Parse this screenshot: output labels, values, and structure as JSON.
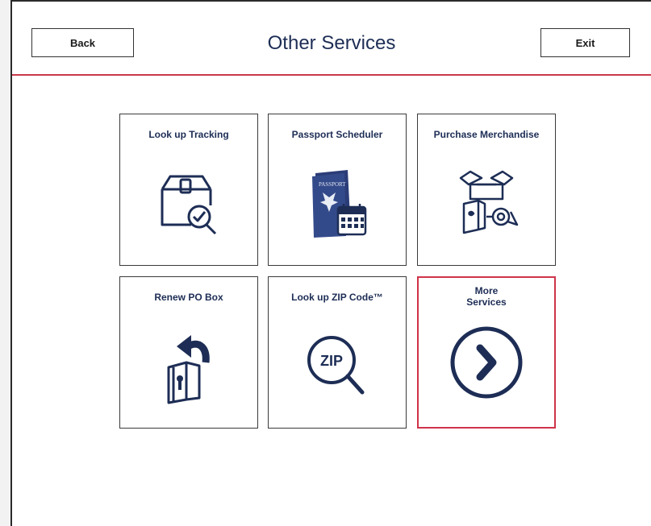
{
  "header": {
    "title": "Other Services",
    "back_label": "Back",
    "exit_label": "Exit"
  },
  "tiles": [
    {
      "label": "Look up Tracking",
      "icon": "package-tracking-icon"
    },
    {
      "label": "Passport Scheduler",
      "icon": "passport-calendar-icon"
    },
    {
      "label": "Purchase Merchandise",
      "icon": "merchandise-icon"
    },
    {
      "label": "Renew PO Box",
      "icon": "po-box-renew-icon"
    },
    {
      "label": "Look up ZIP Code™",
      "icon": "zip-search-icon",
      "icon_text": "ZIP"
    },
    {
      "label": "More\nServices",
      "icon": "arrow-circle-icon"
    }
  ],
  "colors": {
    "navy": "#1d2d55",
    "accent_red": "#c8394a",
    "passport_blue": "#2b3d78"
  }
}
